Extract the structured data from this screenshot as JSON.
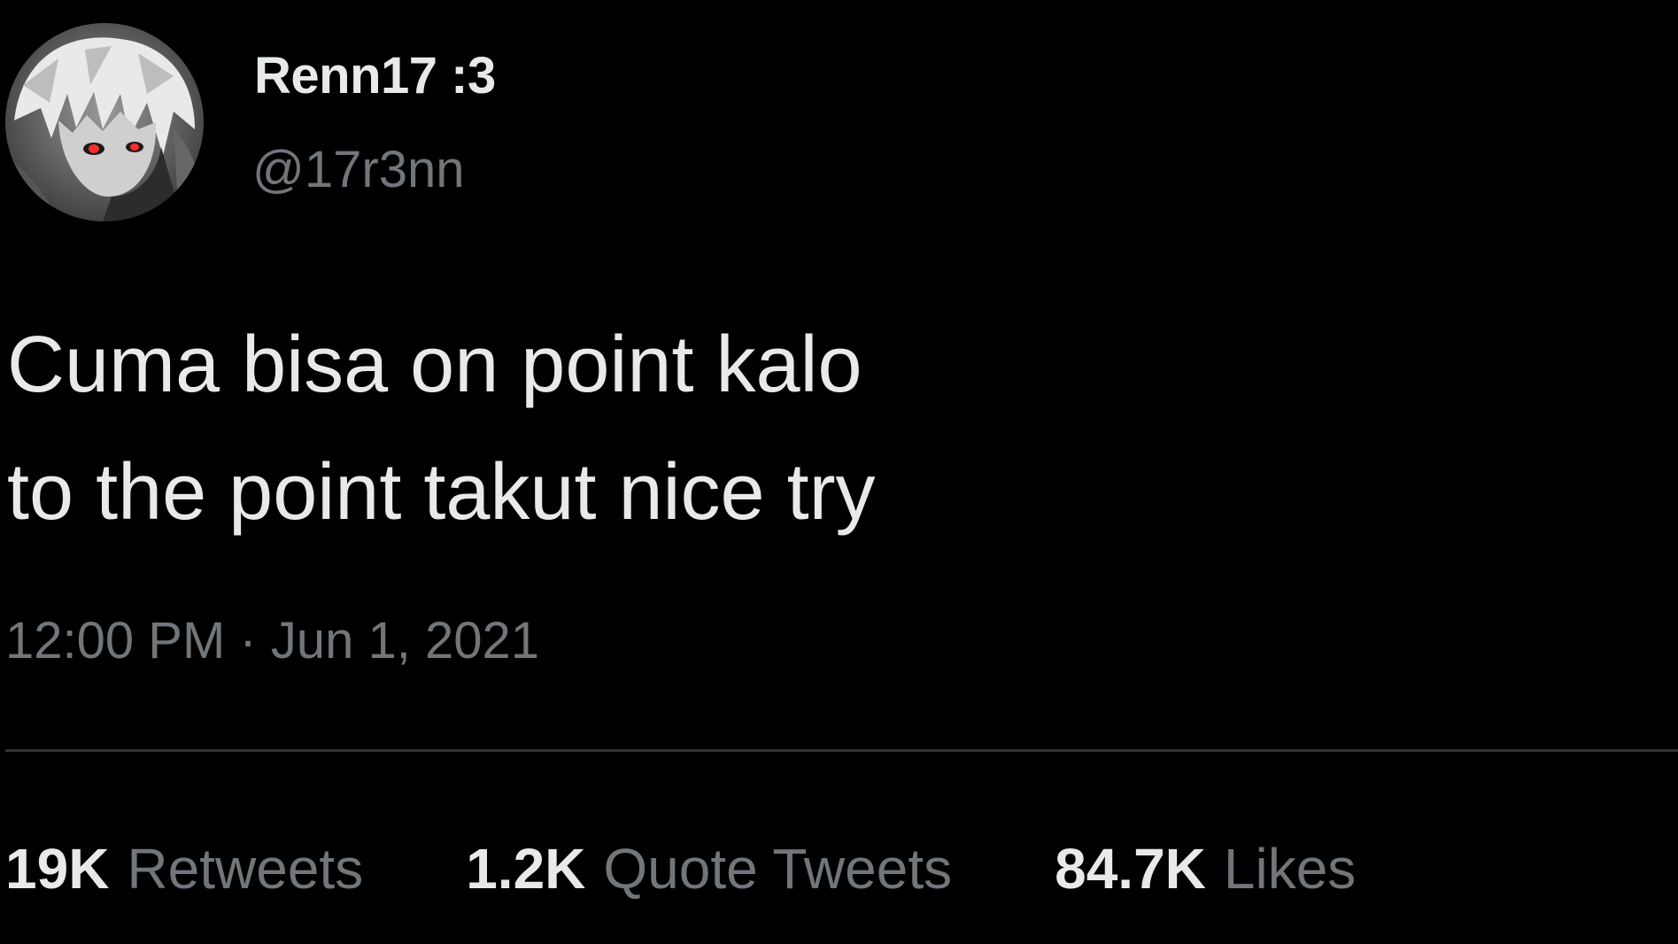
{
  "user": {
    "display_name": "Renn17 :3",
    "handle": "@17r3nn"
  },
  "tweet": {
    "lines": [
      "Cuma bisa on point kalo",
      "to the point takut nice try"
    ],
    "time": "12:00 PM",
    "separator": "·",
    "date": "Jun 1, 2021"
  },
  "stats": [
    {
      "count": "19K",
      "label": "Retweets"
    },
    {
      "count": "1.2K",
      "label": "Quote Tweets"
    },
    {
      "count": "84.7K",
      "label": "Likes"
    }
  ],
  "colors": {
    "background": "#000000",
    "primary_text": "#e7e9ea",
    "secondary_text": "#71767b",
    "divider": "#2f3336",
    "avatar_eye": "#ff2a2a"
  },
  "icons": {
    "avatar": "anime-character-avatar"
  }
}
